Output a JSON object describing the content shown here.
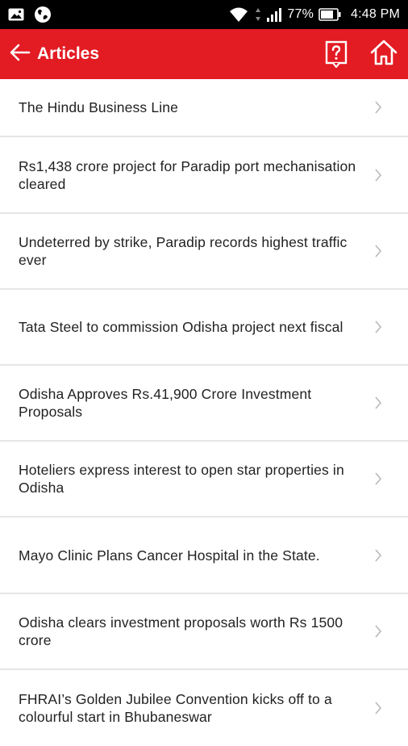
{
  "status_bar": {
    "battery_percent": "77%",
    "time": "4:48 PM",
    "icons": [
      "image-icon",
      "globe-icon",
      "wifi-icon",
      "signal-icon",
      "battery-icon"
    ]
  },
  "app_bar": {
    "title": "Articles",
    "back_icon": "arrow-left-icon",
    "help_icon": "question-box-icon",
    "home_icon": "home-icon",
    "color": "#e31b23"
  },
  "articles": [
    {
      "title": "The Hindu Business Line"
    },
    {
      "title": "Rs1,438 crore project for Paradip port mechanisation cleared"
    },
    {
      "title": "Undeterred by strike, Paradip records highest traffic ever"
    },
    {
      "title": "Tata Steel to commission Odisha project next fiscal"
    },
    {
      "title": "Odisha Approves Rs.41,900 Crore Investment Proposals"
    },
    {
      "title": "Hoteliers express interest to open star properties in Odisha"
    },
    {
      "title": "Mayo Clinic Plans Cancer Hospital in the State."
    },
    {
      "title": "Odisha clears investment proposals worth Rs 1500 crore"
    },
    {
      "title": "FHRAI’s Golden Jubilee Convention kicks off to a colourful start in Bhubaneswar"
    }
  ]
}
